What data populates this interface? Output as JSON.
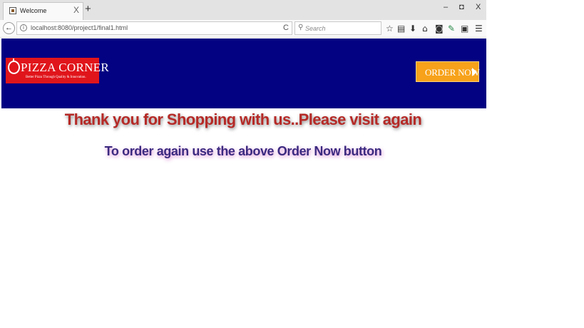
{
  "browser": {
    "tab_title": "Welcome",
    "tab_close": "X",
    "new_tab": "+",
    "window_controls": {
      "minimize": "–",
      "restore": "◘",
      "close": "X"
    },
    "url": "localhost:8080/project1/final1.html",
    "search_placeholder": "Search",
    "toolbar_icons": [
      "star-icon",
      "reader-icon",
      "download-icon",
      "home-icon",
      "pocket-icon",
      "extension-icon",
      "sidebar-icon",
      "menu-icon"
    ]
  },
  "page": {
    "logo": {
      "brand": "PIZZA CORNER",
      "tagline": "Better Pizza Through Quality & Innovation."
    },
    "order_button": "ORDER NOW",
    "thank_you": "Thank you for Shopping with us..Please visit again",
    "order_again": "To order again use the above Order Now button"
  },
  "colors": {
    "header_bg": "#020282",
    "logo_bg": "#e0151b",
    "order_button_bg": "#f7a21a",
    "thank_you_text": "#b52a27",
    "order_again_text": "#3b2a80"
  }
}
